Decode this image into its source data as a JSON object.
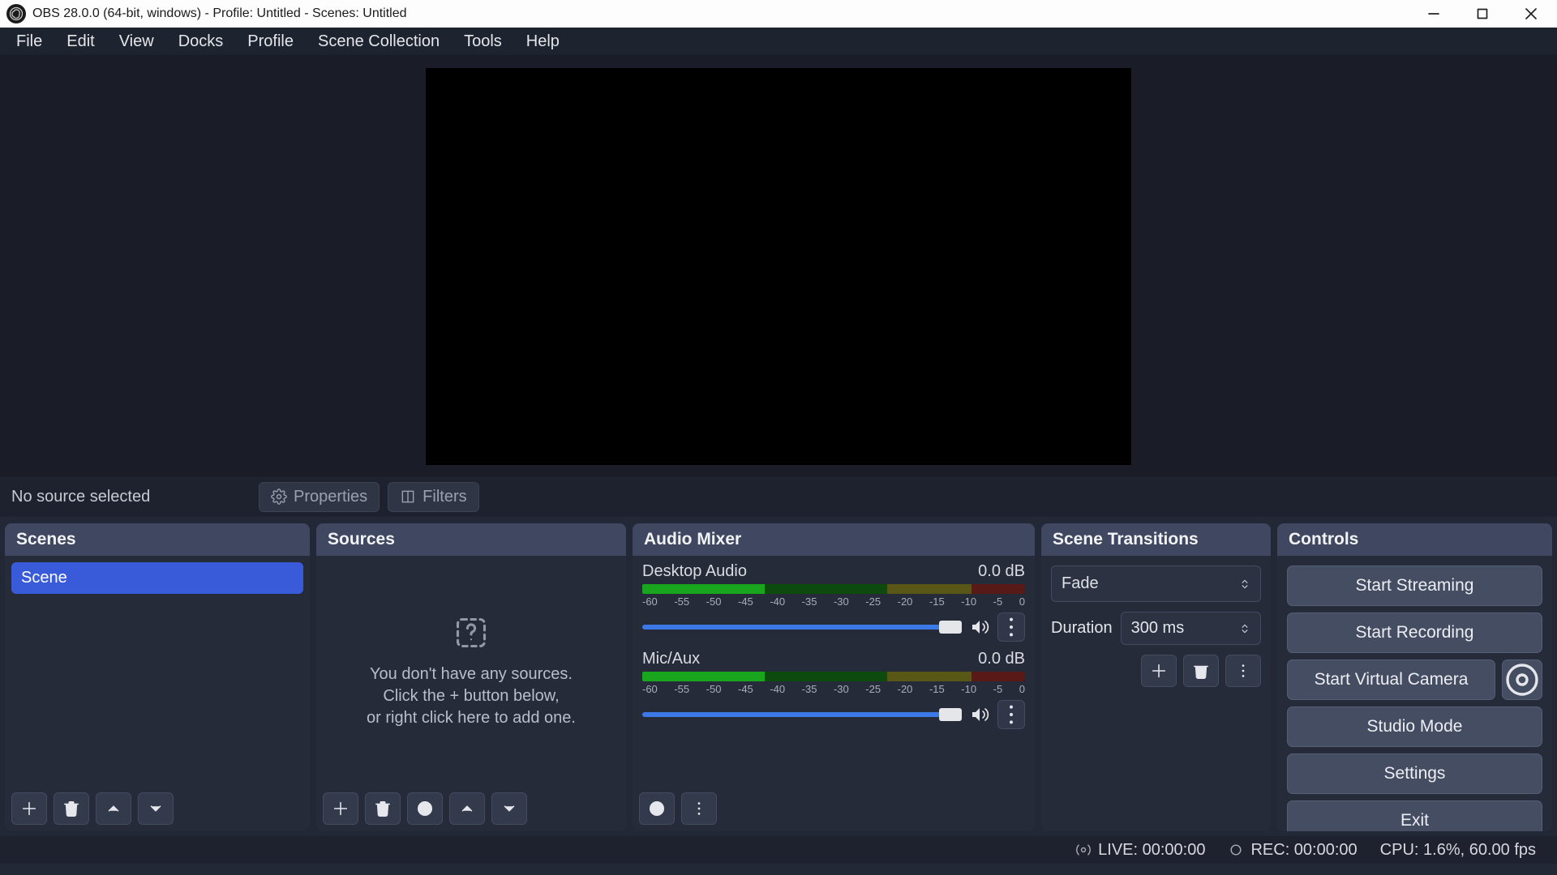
{
  "title": "OBS 28.0.0 (64-bit, windows) - Profile: Untitled - Scenes: Untitled",
  "menu": [
    "File",
    "Edit",
    "View",
    "Docks",
    "Profile",
    "Scene Collection",
    "Tools",
    "Help"
  ],
  "source_toolbar": {
    "message": "No source selected",
    "properties": "Properties",
    "filters": "Filters"
  },
  "docks": {
    "scenes": {
      "title": "Scenes",
      "items": [
        "Scene"
      ]
    },
    "sources": {
      "title": "Sources",
      "empty_lines": [
        "You don't have any sources.",
        "Click the + button below,",
        "or right click here to add one."
      ]
    },
    "mixer": {
      "title": "Audio Mixer",
      "ticks": [
        "-60",
        "-55",
        "-50",
        "-45",
        "-40",
        "-35",
        "-30",
        "-25",
        "-20",
        "-15",
        "-10",
        "-5",
        "0"
      ],
      "channels": [
        {
          "name": "Desktop Audio",
          "db": "0.0 dB"
        },
        {
          "name": "Mic/Aux",
          "db": "0.0 dB"
        }
      ]
    },
    "transitions": {
      "title": "Scene Transitions",
      "selected": "Fade",
      "duration_label": "Duration",
      "duration_value": "300 ms"
    },
    "controls": {
      "title": "Controls",
      "buttons": {
        "start_streaming": "Start Streaming",
        "start_recording": "Start Recording",
        "start_vcam": "Start Virtual Camera",
        "studio_mode": "Studio Mode",
        "settings": "Settings",
        "exit": "Exit"
      }
    }
  },
  "status": {
    "live": "LIVE: 00:00:00",
    "rec": "REC: 00:00:00",
    "cpu": "CPU: 1.6%, 60.00 fps"
  }
}
